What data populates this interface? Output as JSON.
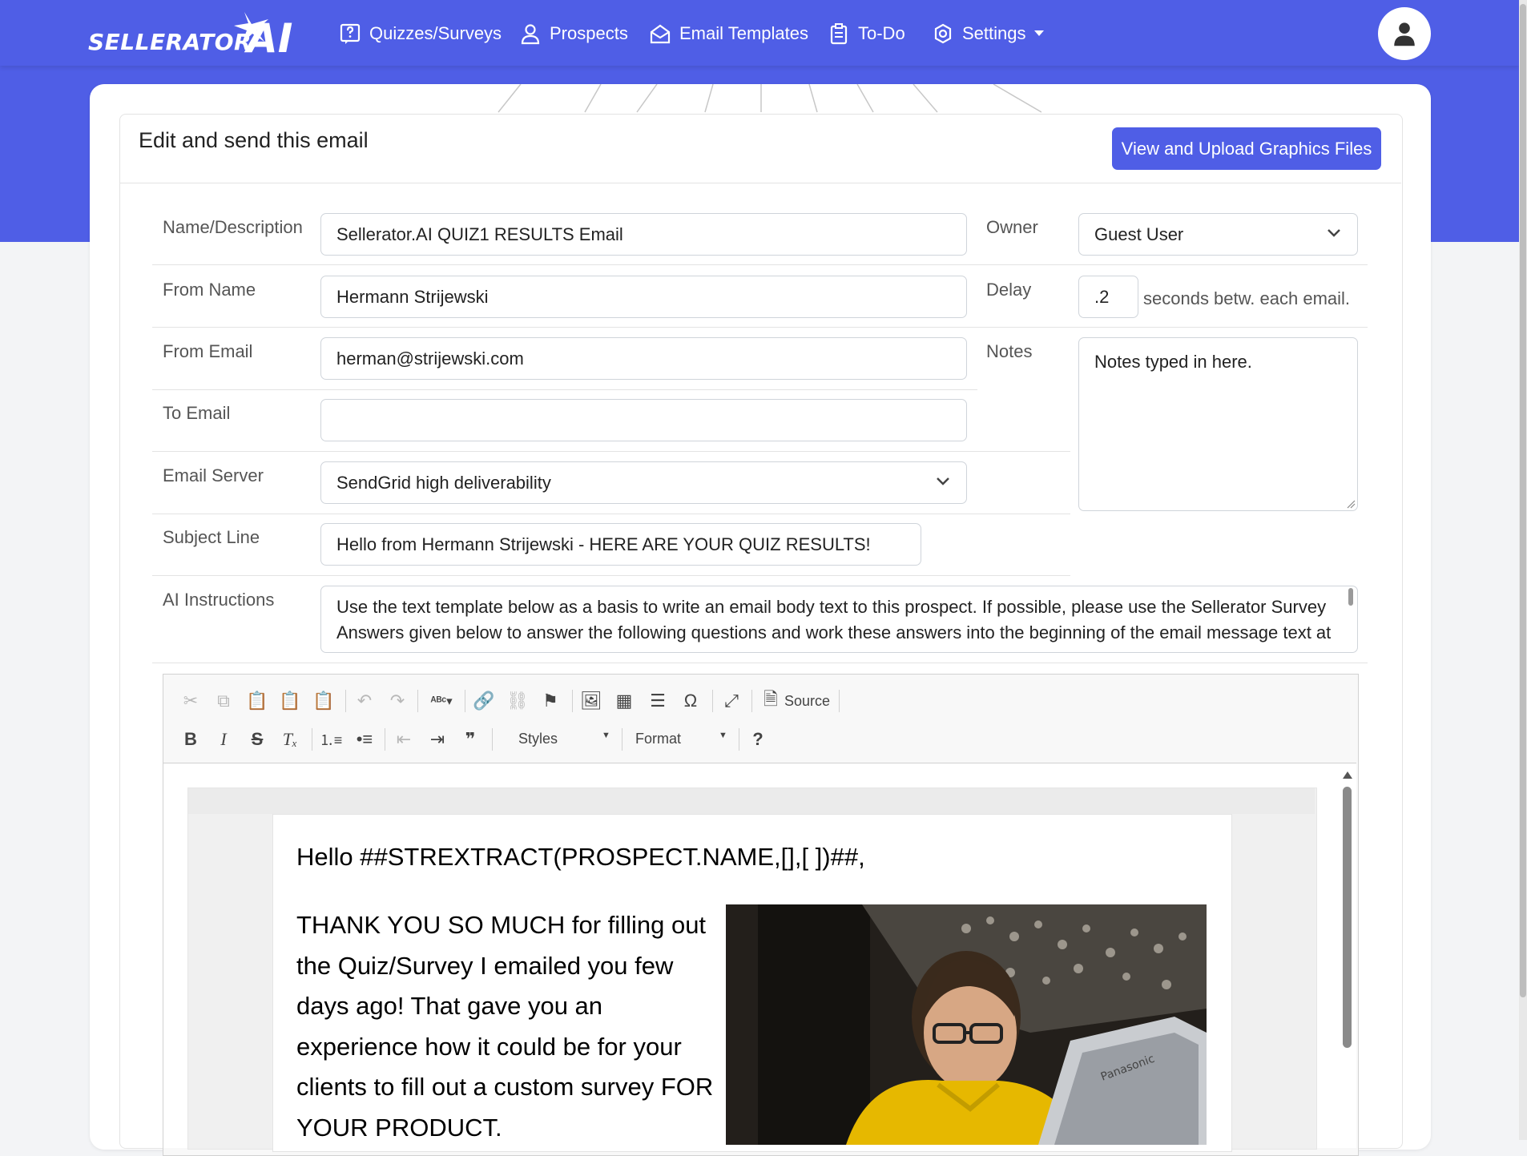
{
  "nav": {
    "logo_text": "SELLERATOR AI",
    "items": [
      {
        "label": "Quizzes/Surveys",
        "icon": "question-square-icon"
      },
      {
        "label": "Prospects",
        "icon": "person-icon"
      },
      {
        "label": "Email Templates",
        "icon": "envelope-open-icon"
      },
      {
        "label": "To-Do",
        "icon": "clipboard-icon"
      },
      {
        "label": "Settings",
        "icon": "gear-icon"
      }
    ]
  },
  "card": {
    "title": "Edit and send this email",
    "upload_button": "View and Upload Graphics Files"
  },
  "form": {
    "name_label": "Name/Description",
    "name_value": "Sellerator.AI QUIZ1 RESULTS Email",
    "owner_label": "Owner",
    "owner_value": "Guest User",
    "from_name_label": "From Name",
    "from_name_value": "Hermann Strijewski",
    "delay_label": "Delay",
    "delay_value": ".2",
    "delay_suffix": "seconds betw. each email.",
    "from_email_label": "From Email",
    "from_email_value": "herman@strijewski.com",
    "notes_label": "Notes",
    "notes_value": "Notes typed in here.",
    "to_email_label": "To Email",
    "to_email_value": "",
    "server_label": "Email Server",
    "server_value": "SendGrid high deliverability",
    "subject_label": "Subject Line",
    "subject_value": "Hello from Hermann Strijewski - HERE ARE YOUR QUIZ RESULTS!",
    "ai_label": "AI Instructions",
    "ai_value": "Use the text template below as a basis to write an email body text to this prospect. If possible, please use the Sellerator Survey Answers given below to answer the following questions and work these answers into the beginning of the email message text at"
  },
  "editor": {
    "source_label": "Source",
    "styles_label": "Styles",
    "format_label": "Format",
    "greeting": "Hello ##STREXTRACT(PROSPECT.NAME,[],[ ])##,",
    "paragraph": "THANK YOU SO MUCH for filling out the Quiz/Survey I emailed you few days ago! That gave you an experience how it could be for your clients to fill out a custom survey FOR YOUR PRODUCT."
  }
}
